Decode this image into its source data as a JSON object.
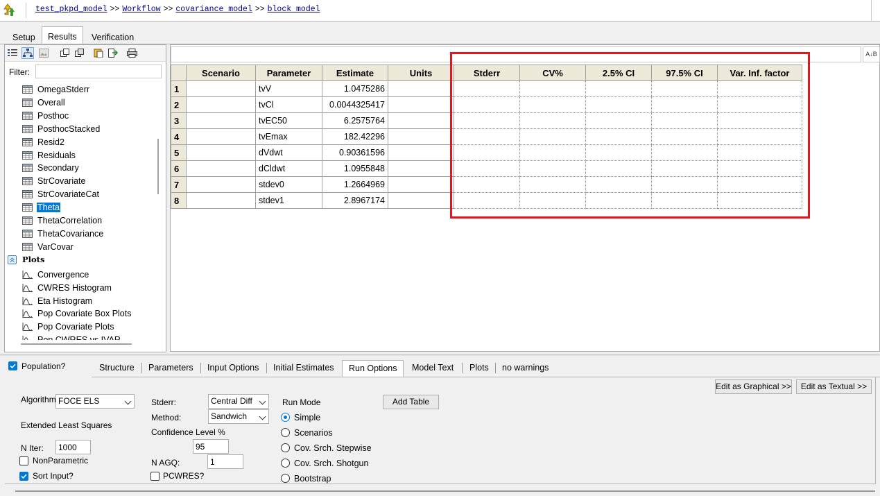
{
  "breadcrumb": {
    "items": [
      "test_pkpd_model",
      "Workflow",
      "covariance model",
      "block model"
    ],
    "separator": ">>"
  },
  "main_tabs": [
    "Setup",
    "Results",
    "Verification"
  ],
  "left_panel": {
    "filter_label": "Filter:",
    "filter_value": "",
    "tree_items": [
      "OmegaStderr",
      "Overall",
      "Posthoc",
      "PosthocStacked",
      "Resid2",
      "Residuals",
      "Secondary",
      "StrCovariate",
      "StrCovariateCat",
      "Theta",
      "ThetaCorrelation",
      "ThetaCovariance",
      "VarCovar"
    ],
    "selected_item": "Theta",
    "group_label": "Plots",
    "plot_items": [
      "Convergence",
      "CWRES Histogram",
      "Eta Histogram",
      "Pop Covariate Box Plots",
      "Pop Covariate Plots",
      "Pop CWRES vs IVAR"
    ]
  },
  "grid": {
    "search_value": "",
    "sort_icon": "sort-az-icon",
    "columns": [
      "Scenario",
      "Parameter",
      "Estimate",
      "Units",
      "Stderr",
      "CV%",
      "2.5% CI",
      "97.5% CI",
      "Var. Inf. factor"
    ],
    "rows": [
      {
        "n": "1",
        "scenario": "",
        "parameter": "tvV",
        "estimate": "1.0475286",
        "units": ""
      },
      {
        "n": "2",
        "scenario": "",
        "parameter": "tvCl",
        "estimate": "0.0044325417",
        "units": ""
      },
      {
        "n": "3",
        "scenario": "",
        "parameter": "tvEC50",
        "estimate": "6.2575764",
        "units": ""
      },
      {
        "n": "4",
        "scenario": "",
        "parameter": "tvEmax",
        "estimate": "182.42296",
        "units": ""
      },
      {
        "n": "5",
        "scenario": "",
        "parameter": "dVdwt",
        "estimate": "0.90361596",
        "units": ""
      },
      {
        "n": "6",
        "scenario": "",
        "parameter": "dCldwt",
        "estimate": "1.0955848",
        "units": ""
      },
      {
        "n": "7",
        "scenario": "",
        "parameter": "stdev0",
        "estimate": "1.2664969",
        "units": ""
      },
      {
        "n": "8",
        "scenario": "",
        "parameter": "stdev1",
        "estimate": "2.8967174",
        "units": ""
      }
    ],
    "highlight_color": "#e8141c"
  },
  "bottom": {
    "population_label": "Population?",
    "population_checked": true,
    "tabs": [
      "Structure",
      "Parameters",
      "Input Options",
      "Initial Estimates",
      "Run Options",
      "Model Text",
      "Plots",
      "no warnings"
    ],
    "active_tab": "Run Options",
    "edit_graphical": "Edit as Graphical >>",
    "edit_textual": "Edit as Textual >>",
    "algorithm_label": "Algorithm",
    "algorithm_value": "FOCE ELS",
    "algorithm_desc": "Extended Least Squares",
    "niter_label": "N Iter:",
    "niter_value": "1000",
    "nonparametric_label": "NonParametric",
    "nonparametric_checked": false,
    "sort_input_label": "Sort Input?",
    "sort_input_checked": true,
    "stderr_label": "Stderr:",
    "stderr_value": "Central Diff",
    "method_label": "Method:",
    "method_value": "Sandwich",
    "confidence_label": "Confidence Level %",
    "confidence_value": "95",
    "nagq_label": "N AGQ:",
    "nagq_value": "1",
    "pcwres_label": "PCWRES?",
    "pcwres_checked": false,
    "run_mode_label": "Run Mode",
    "run_modes": [
      "Simple",
      "Scenarios",
      "Cov. Srch. Stepwise",
      "Cov. Srch. Shotgun",
      "Bootstrap"
    ],
    "run_mode_selected": "Simple",
    "add_table_label": "Add Table",
    "accent_color": "#0078d7"
  }
}
